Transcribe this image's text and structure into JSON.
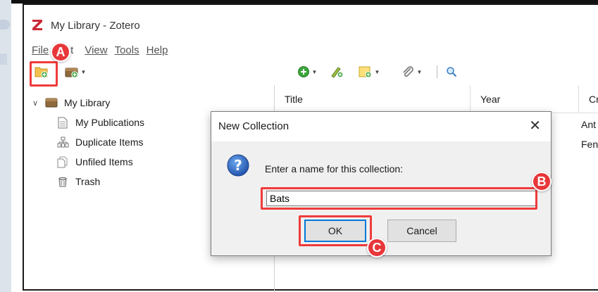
{
  "window": {
    "title": "My Library - Zotero"
  },
  "menubar": {
    "items": [
      {
        "label": "File",
        "icon": ""
      },
      {
        "label": "Edit"
      },
      {
        "label": "View"
      },
      {
        "label": "Tools"
      },
      {
        "label": "Help"
      }
    ],
    "edit_visible": "t"
  },
  "toolbar": {
    "icons": [
      "new-collection-icon",
      "new-library-icon",
      "new-item-icon",
      "add-by-identifier-icon",
      "new-note-icon",
      "attachment-icon",
      "search-icon"
    ]
  },
  "tree": {
    "root_label": "My Library",
    "items": [
      {
        "label": "My Publications",
        "icon": "document-icon"
      },
      {
        "label": "Duplicate Items",
        "icon": "duplicate-icon"
      },
      {
        "label": "Unfiled Items",
        "icon": "unfiled-icon"
      },
      {
        "label": "Trash",
        "icon": "trash-icon"
      }
    ]
  },
  "items_table": {
    "columns": [
      "Title",
      "Year",
      "Cr"
    ],
    "creator_cells": [
      "Ant",
      "Fen"
    ]
  },
  "dialog": {
    "title": "New Collection",
    "close_glyph": "✕",
    "prompt": "Enter a name for this collection:",
    "input_value": "Bats",
    "ok_label": "OK",
    "cancel_label": "Cancel"
  },
  "annotations": {
    "markers": [
      "A",
      "B",
      "C"
    ],
    "color": "#e8373a"
  }
}
